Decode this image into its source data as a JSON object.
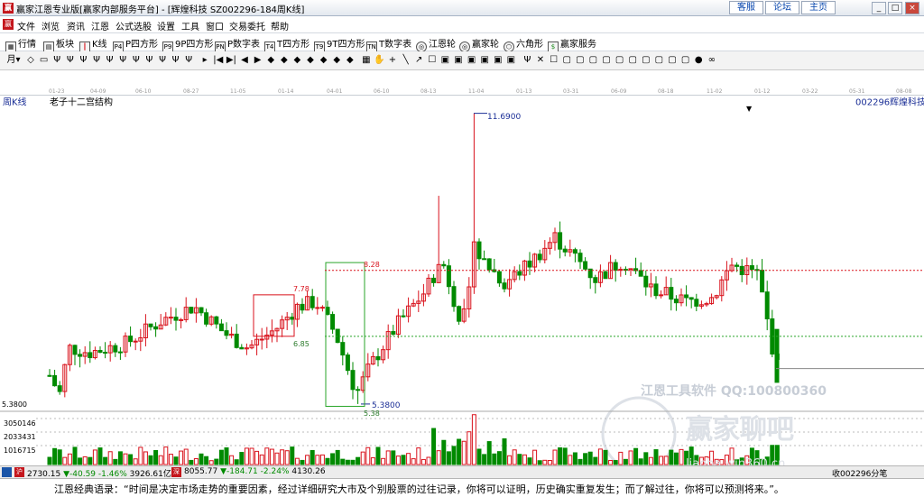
{
  "window": {
    "title": "赢家江恩专业版[赢家内部服务平台] - [辉煌科技  SZ002296-184周K线]",
    "links": [
      "客服",
      "论坛",
      "主页"
    ],
    "controls": [
      "_",
      "□",
      "×"
    ]
  },
  "menu": [
    "文件",
    "浏览",
    "资讯",
    "江恩",
    "公式选股",
    "设置",
    "工具",
    "窗口",
    "交易委托",
    "帮助"
  ],
  "toolbar": [
    {
      "label": "行情",
      "icon": "grid-icon"
    },
    {
      "label": "板块",
      "icon": "blocks-icon"
    },
    {
      "label": "K线",
      "icon": "kline-icon"
    },
    {
      "label": "P四方形",
      "icon": "p-square-icon",
      "tag": "P4"
    },
    {
      "label": "9P四方形",
      "icon": "9p-square-icon",
      "tag": "P9"
    },
    {
      "label": "P数字表",
      "icon": "p-number-table-icon",
      "tag": "PN"
    },
    {
      "label": "T四方形",
      "icon": "t-square-icon",
      "tag": "T4"
    },
    {
      "label": "9T四方形",
      "icon": "9t-square-icon",
      "tag": "T9"
    },
    {
      "label": "T数字表",
      "icon": "t-number-table-icon",
      "tag": "TN"
    },
    {
      "label": "江恩轮",
      "icon": "gann-wheel-icon",
      "tag": "◎"
    },
    {
      "label": "赢家轮",
      "icon": "winner-wheel-icon",
      "tag": "◎"
    },
    {
      "label": "六角形",
      "icon": "hexagon-icon",
      "tag": "⬡"
    },
    {
      "label": "赢家服务",
      "icon": "service-icon",
      "tag": "$"
    }
  ],
  "toolbar2": {
    "period": "月"
  },
  "dates": [
    "01-23",
    "04-09",
    "06-10",
    "08-27",
    "11-05",
    "01-14",
    "04-01",
    "06-10",
    "08-13",
    "11-04",
    "01-13",
    "03-31",
    "06-09",
    "08-18",
    "11-02",
    "01-12",
    "03-22",
    "05-31",
    "08-08"
  ],
  "chart": {
    "period_label": "周K线",
    "study_label": "老子十二宫结构",
    "symbol": "002296",
    "name": "辉煌科技",
    "price_axis_label": "5.3800",
    "volume_axis_labels": [
      "3050146",
      "2033431",
      "1016715"
    ],
    "annotations": {
      "high": "11.6900",
      "low_left": "5.3800",
      "low": "5.38",
      "resist": "8.28",
      "box_top": "7.78",
      "box_bottom": "6.85"
    },
    "watermark_text": "江恩工具软件  QQ:100800360",
    "watermark_logo": "赢家聊吧",
    "watermark_url": "liaoba.win360.cn"
  },
  "chart_data": {
    "type": "candlestick",
    "title": "老子十二宫结构",
    "series": [
      {
        "name": "辉煌科技",
        "values": [
          6.0,
          5.6,
          6.5,
          6.7,
          6.5,
          6.8,
          7.3,
          7.8,
          6.9,
          5.38,
          6.2,
          7.6,
          8.6,
          7.2,
          9.0,
          8.4,
          9.1,
          7.9,
          8.3,
          7.4,
          8.6,
          8.2,
          8.4,
          8.0,
          7.6,
          6.6,
          5.8
        ]
      }
    ],
    "xlabel": "",
    "ylabel": "",
    "ylim": [
      5.3,
      11.8
    ]
  },
  "status": {
    "sh_index": "2730.15",
    "sh_change": "▼-40.59",
    "sh_pct": "-1.46%",
    "sh_amount": "3926.61亿",
    "sz_index": "8055.77",
    "sz_change": "▼-184.71",
    "sz_pct": "-2.24%",
    "sz_amount": "4130.26",
    "sh_tag": "沪",
    "sz_tag": "深",
    "right": "收002296分笔"
  },
  "quote": "江恩经典语录：“时间是决定市场走势的重要因素，经过详细研究大市及个别股票的过往记录，你将可以证明，历史确实重复发生；而了解过往，你将可以预测将来。”。",
  "colors": {
    "up": "#d9121c",
    "down": "#008a00",
    "line_blue": "#1a2e96"
  }
}
